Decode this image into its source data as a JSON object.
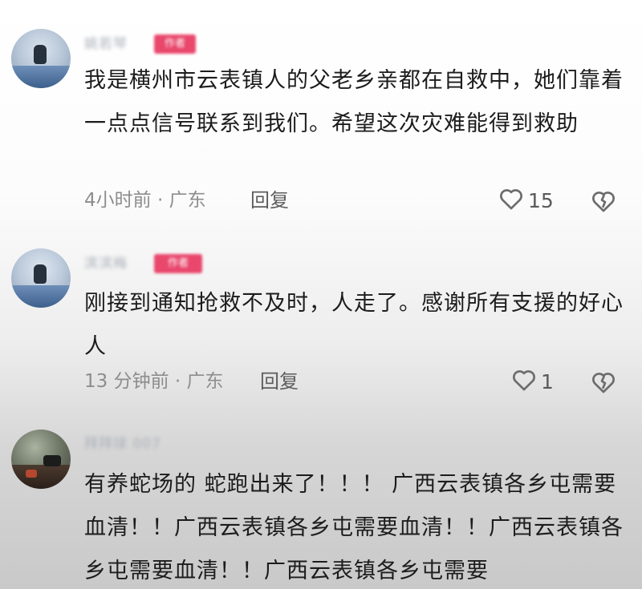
{
  "comments": [
    {
      "username": "姚若琴",
      "badge": "作者",
      "text": "我是横州市云表镇人的父老乡亲都在自救中，她们靠着一点点信号联系到我们。希望这次灾难能得到救助",
      "meta": "4小时前 · 广东",
      "reply_label": "回复",
      "like_count": "15"
    },
    {
      "username": "滨滨梅",
      "badge": "作者",
      "text": "刚接到通知抢救不及时，人走了。感谢所有支援的好心人",
      "meta": "13 分钟前 · 广东",
      "reply_label": "回复",
      "like_count": "1"
    },
    {
      "username": "拜拜球 007",
      "text": "有养蛇场的 蛇跑出来了！！！ 广西云表镇各乡屯需要血清！！广西云表镇各乡屯需要血清！！广西云表镇各乡屯需要血清！！广西云表镇各乡屯需要"
    }
  ],
  "icons": {
    "like": "heart-outline-icon",
    "dislike": "broken-heart-icon"
  },
  "colors": {
    "badge": "#e9476c",
    "meta_text": "#8d8d8d",
    "body_text": "#1c1c1c"
  }
}
